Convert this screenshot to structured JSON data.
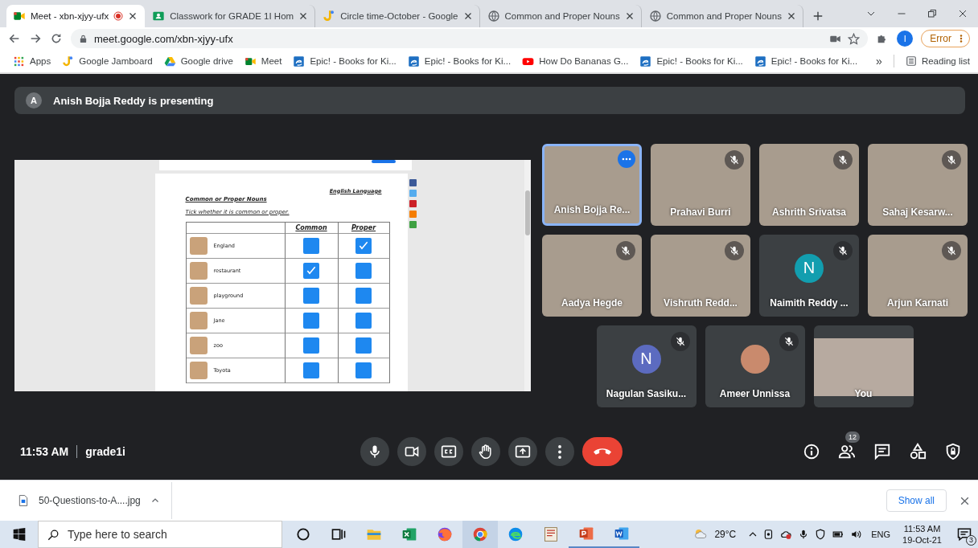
{
  "browser": {
    "tabs": [
      {
        "title": "Meet - xbn-xjyy-ufx",
        "kind": "meet",
        "selected": true,
        "recording": true
      },
      {
        "title": "Classwork for GRADE 1I Hom",
        "kind": "classroom",
        "selected": false,
        "recording": false
      },
      {
        "title": "Circle time-October - Google",
        "kind": "jamboard",
        "selected": false,
        "recording": false
      },
      {
        "title": "Common and Proper Nouns",
        "kind": "globe",
        "selected": false,
        "recording": false
      },
      {
        "title": "Common and Proper Nouns",
        "kind": "globe",
        "selected": false,
        "recording": false
      }
    ],
    "address": "meet.google.com/xbn-xjyy-ufx",
    "profile_initial": "I",
    "error_label": "Error",
    "bookmarks": [
      {
        "label": "Apps",
        "kind": "apps"
      },
      {
        "label": "Google Jamboard",
        "kind": "jamboard"
      },
      {
        "label": "Google drive",
        "kind": "drive"
      },
      {
        "label": "Meet",
        "kind": "meet"
      },
      {
        "label": "Epic! - Books for Ki...",
        "kind": "epic"
      },
      {
        "label": "Epic! - Books for Ki...",
        "kind": "epic"
      },
      {
        "label": "How Do Bananas G...",
        "kind": "youtube"
      },
      {
        "label": "Epic! - Books for Ki...",
        "kind": "epic"
      },
      {
        "label": "Epic! - Books for Ki...",
        "kind": "epic"
      }
    ],
    "overflow": "»",
    "reading_list": "Reading list"
  },
  "meet": {
    "presenter_initial": "A",
    "banner": "Anish Bojja Reddy is presenting",
    "worksheet": {
      "subject": "English Language",
      "title": "Common or Proper Nouns",
      "instruction": "Tick whether it is common or proper.",
      "columns": [
        "Common",
        "Proper"
      ],
      "rows": [
        {
          "word": "England",
          "common": false,
          "proper": true
        },
        {
          "word": "restaurant",
          "common": true,
          "proper": false
        },
        {
          "word": "playground",
          "common": false,
          "proper": false
        },
        {
          "word": "Jane",
          "common": false,
          "proper": false
        },
        {
          "word": "zoo",
          "common": false,
          "proper": false
        },
        {
          "word": "Toyota",
          "common": false,
          "proper": false
        }
      ]
    },
    "participants": [
      {
        "name": "Anish Bojja Re...",
        "kind": "video",
        "muted": false,
        "highlighted": true
      },
      {
        "name": "Prahavi Burri",
        "kind": "video",
        "muted": true,
        "highlighted": false
      },
      {
        "name": "Ashrith Srivatsa",
        "kind": "video",
        "muted": true,
        "highlighted": false
      },
      {
        "name": "Sahaj Kesarw...",
        "kind": "video",
        "muted": true,
        "highlighted": false
      },
      {
        "name": "Aadya Hegde",
        "kind": "video",
        "muted": true,
        "highlighted": false
      },
      {
        "name": "Vishruth Redd...",
        "kind": "video",
        "muted": true,
        "highlighted": false
      },
      {
        "name": "Naimith Reddy ...",
        "kind": "avatar",
        "initial": "N",
        "color": "#129eaf",
        "muted": true,
        "highlighted": false
      },
      {
        "name": "Arjun Karnati",
        "kind": "video",
        "muted": true,
        "highlighted": false
      },
      {
        "name": "Nagulan Sasiku...",
        "kind": "avatar",
        "initial": "N",
        "color": "#5c6bc0",
        "muted": true,
        "highlighted": false
      },
      {
        "name": "Ameer Unnissa",
        "kind": "photo",
        "muted": true,
        "highlighted": false
      },
      {
        "name": "You",
        "kind": "self",
        "muted": false,
        "highlighted": false
      }
    ],
    "time": "11:53 AM",
    "meeting_code": "grade1i",
    "people_count": "12"
  },
  "downloads": {
    "file": "50-Questions-to-A....jpg",
    "show_all": "Show all"
  },
  "taskbar": {
    "search_placeholder": "Type here to search",
    "temperature": "29°C",
    "language": "ENG",
    "time": "11:53 AM",
    "date": "19-Oct-21",
    "notification_count": "3"
  }
}
